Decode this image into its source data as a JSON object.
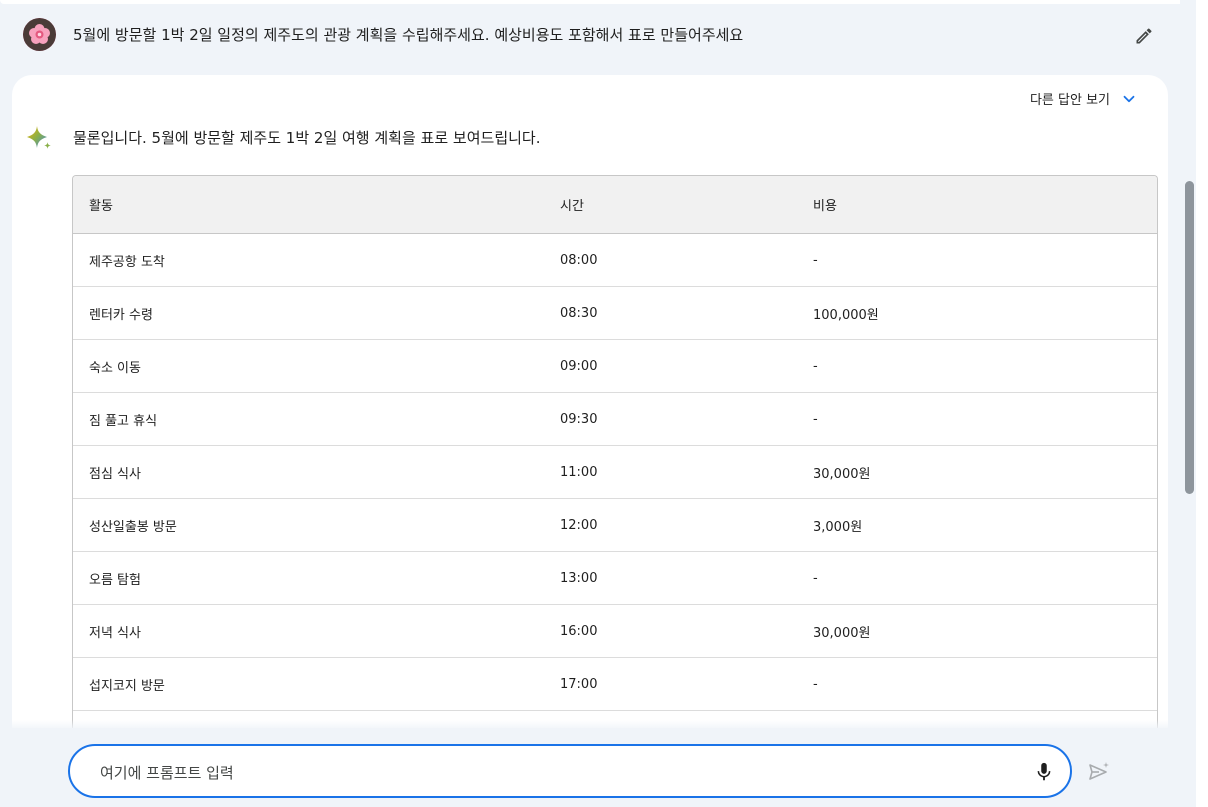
{
  "prompt": {
    "text": "5월에 방문할 1박 2일 일정의 제주도의 관광 계획을 수립해주세요. 예상비용도 포함해서 표로 만들어주세요"
  },
  "response": {
    "other_answers_label": "다른 답안 보기",
    "intro": "물론입니다. 5월에 방문할 제주도 1박 2일 여행 계획을 표로 보여드립니다.",
    "table": {
      "headers": [
        "활동",
        "시간",
        "비용"
      ],
      "rows": [
        [
          "제주공항 도착",
          "08:00",
          "-"
        ],
        [
          "렌터카 수령",
          "08:30",
          "100,000원"
        ],
        [
          "숙소 이동",
          "09:00",
          "-"
        ],
        [
          "짐 풀고 휴식",
          "09:30",
          "-"
        ],
        [
          "점심 식사",
          "11:00",
          "30,000원"
        ],
        [
          "성산일출봉 방문",
          "12:00",
          "3,000원"
        ],
        [
          "오름 탐험",
          "13:00",
          "-"
        ],
        [
          "저녁 식사",
          "16:00",
          "30,000원"
        ],
        [
          "섭지코지 방문",
          "17:00",
          "-"
        ]
      ]
    }
  },
  "input": {
    "placeholder": "여기에 프롬프트 입력",
    "value": ""
  },
  "icons": {
    "edit": "pencil-icon",
    "chevron": "chevron-down-icon",
    "sparkle": "sparkle-icon",
    "mic": "mic-icon",
    "send": "send-icon"
  },
  "colors": {
    "accent": "#1a73e8",
    "page_bg": "#f0f4f9",
    "card_bg": "#ffffff",
    "table_header_bg": "#f1f1f1"
  }
}
